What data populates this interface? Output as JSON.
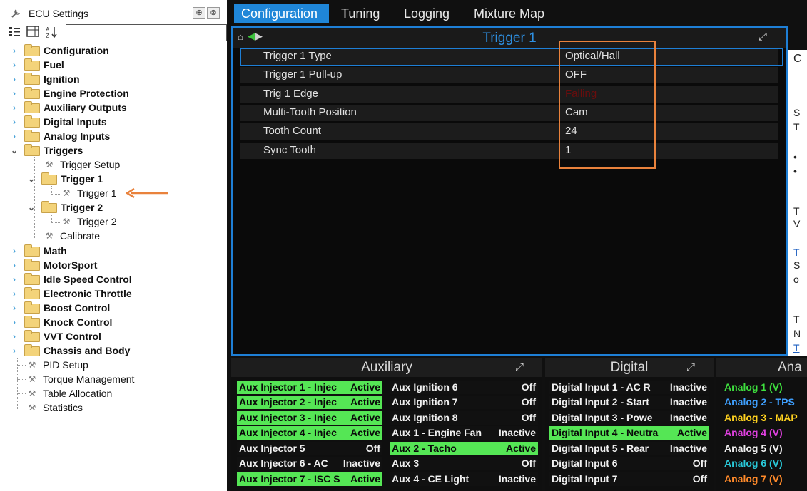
{
  "left_panel": {
    "title": "ECU Settings",
    "pin_icon": "pin-icon",
    "close_icon": "close-icon",
    "pin_glyph": "⊕",
    "close_glyph": "⊗",
    "tree": [
      {
        "label": "Configuration",
        "type": "folder",
        "expanded": false
      },
      {
        "label": "Fuel",
        "type": "folder",
        "expanded": false
      },
      {
        "label": "Ignition",
        "type": "folder",
        "expanded": false
      },
      {
        "label": "Engine Protection",
        "type": "folder",
        "expanded": false
      },
      {
        "label": "Auxiliary Outputs",
        "type": "folder",
        "expanded": false
      },
      {
        "label": "Digital Inputs",
        "type": "folder",
        "expanded": false
      },
      {
        "label": "Analog Inputs",
        "type": "folder",
        "expanded": false
      },
      {
        "label": "Triggers",
        "type": "folder",
        "expanded": true
      },
      {
        "label": "Trigger Setup",
        "type": "leaf"
      },
      {
        "label": "Trigger 1",
        "type": "folder",
        "expanded": true
      },
      {
        "label": "Trigger 1",
        "type": "leaf",
        "selected": true
      },
      {
        "label": "Trigger 2",
        "type": "folder",
        "expanded": true
      },
      {
        "label": "Trigger 2",
        "type": "leaf"
      },
      {
        "label": "Calibrate",
        "type": "leaf"
      },
      {
        "label": "Math",
        "type": "folder",
        "expanded": false
      },
      {
        "label": "MotorSport",
        "type": "folder",
        "expanded": false
      },
      {
        "label": "Idle Speed Control",
        "type": "folder",
        "expanded": false
      },
      {
        "label": "Electronic Throttle",
        "type": "folder",
        "expanded": false
      },
      {
        "label": "Boost Control",
        "type": "folder",
        "expanded": false
      },
      {
        "label": "Knock Control",
        "type": "folder",
        "expanded": false
      },
      {
        "label": "VVT Control",
        "type": "folder",
        "expanded": false
      },
      {
        "label": "Chassis and Body",
        "type": "folder",
        "expanded": false
      },
      {
        "label": "PID Setup",
        "type": "leaf"
      },
      {
        "label": "Torque Management",
        "type": "leaf"
      },
      {
        "label": "Table Allocation",
        "type": "leaf"
      },
      {
        "label": "Statistics",
        "type": "leaf"
      }
    ]
  },
  "tabs": [
    {
      "label": "Configuration",
      "active": true
    },
    {
      "label": "Tuning",
      "active": false
    },
    {
      "label": "Logging",
      "active": false
    },
    {
      "label": "Mixture Map",
      "active": false
    }
  ],
  "trigger_panel": {
    "title": "Trigger 1",
    "rows": [
      {
        "name": "Trigger 1 Type",
        "value": "Optical/Hall"
      },
      {
        "name": "Trigger 1 Pull-up",
        "value": "OFF"
      },
      {
        "name": "Trig 1 Edge",
        "value": "Falling"
      },
      {
        "name": "Multi-Tooth Position",
        "value": "Cam"
      },
      {
        "name": "Tooth Count",
        "value": "24"
      },
      {
        "name": "Sync Tooth",
        "value": "1"
      }
    ]
  },
  "side_strip": {
    "fragments": [
      "C",
      "T",
      "S",
      "•",
      "•",
      "T",
      "V",
      "T",
      "S",
      "o",
      "T",
      "N",
      "T"
    ]
  },
  "auxiliary": {
    "title": "Auxiliary",
    "col1": [
      {
        "name": "Aux Injector 1 - Injec",
        "value": "Active",
        "on": true
      },
      {
        "name": "Aux Injector 2 - Injec",
        "value": "Active",
        "on": true
      },
      {
        "name": "Aux Injector 3 - Injec",
        "value": "Active",
        "on": true
      },
      {
        "name": "Aux Injector 4 - Injec",
        "value": "Active",
        "on": true
      },
      {
        "name": "Aux Injector 5",
        "value": "Off",
        "on": false
      },
      {
        "name": "Aux Injector 6 - AC",
        "value": "Inactive",
        "on": false
      },
      {
        "name": "Aux Injector 7 - ISC S",
        "value": "Active",
        "on": true
      }
    ],
    "col2": [
      {
        "name": "Aux Ignition 6",
        "value": "Off",
        "on": false
      },
      {
        "name": "Aux Ignition 7",
        "value": "Off",
        "on": false
      },
      {
        "name": "Aux Ignition 8",
        "value": "Off",
        "on": false
      },
      {
        "name": "Aux 1 - Engine Fan",
        "value": "Inactive",
        "on": false
      },
      {
        "name": "Aux 2 - Tacho",
        "value": "Active",
        "on": true
      },
      {
        "name": "Aux 3",
        "value": "Off",
        "on": false
      },
      {
        "name": "Aux 4 - CE Light",
        "value": "Inactive",
        "on": false
      }
    ]
  },
  "digital": {
    "title": "Digital",
    "col1": [
      {
        "name": "Digital Input 1 - AC R",
        "value": "Inactive",
        "on": false
      },
      {
        "name": "Digital Input 2 - Start",
        "value": "Inactive",
        "on": false
      },
      {
        "name": "Digital Input 3 - Powe",
        "value": "Inactive",
        "on": false
      },
      {
        "name": "Digital Input 4 - Neutra",
        "value": "Active",
        "on": true
      },
      {
        "name": "Digital Input 5 - Rear",
        "value": "Inactive",
        "on": false
      },
      {
        "name": "Digital Input 6",
        "value": "Off",
        "on": false
      },
      {
        "name": "Digital Input 7",
        "value": "Off",
        "on": false
      }
    ]
  },
  "analog": {
    "title": "Ana",
    "items": [
      {
        "name": "Analog 1 (V)",
        "color": "#3ee03e"
      },
      {
        "name": "Analog 2 - TPS",
        "color": "#3fa0ff"
      },
      {
        "name": "Analog 3 - MAP",
        "color": "#ffd21f"
      },
      {
        "name": "Analog 4 (V)",
        "color": "#e040e0"
      },
      {
        "name": "Analog 5 (V)",
        "color": "#f0f0f0"
      },
      {
        "name": "Analog 6 (V)",
        "color": "#29c9d9"
      },
      {
        "name": "Analog 7 (V)",
        "color": "#ff8a2a"
      }
    ]
  }
}
